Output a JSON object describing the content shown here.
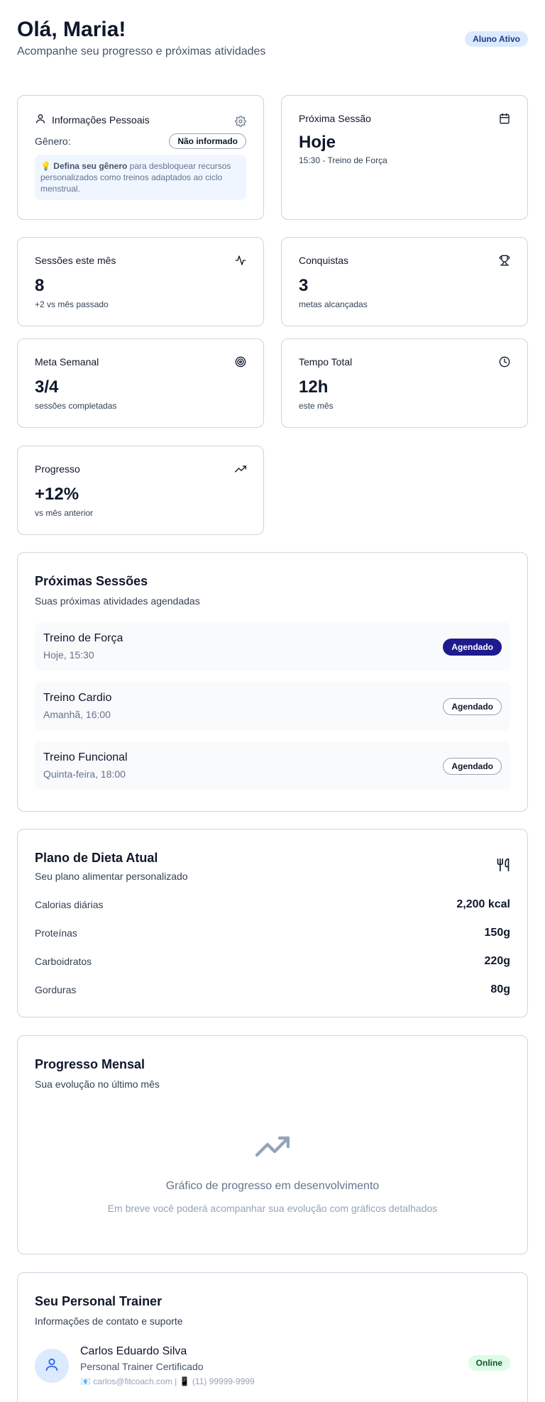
{
  "header": {
    "greeting": "Olá, Maria!",
    "subtitle": "Acompanhe seu progresso e próximas atividades",
    "status_badge": "Aluno Ativo"
  },
  "personal_info": {
    "title": "Informações Pessoais",
    "gender_label": "Gênero:",
    "gender_value": "Não informado",
    "tip_emoji": "💡",
    "tip_bold": "Defina seu gênero",
    "tip_text": " para desbloquear recursos personalizados como treinos adaptados ao ciclo menstrual."
  },
  "next_session": {
    "title": "Próxima Sessão",
    "day": "Hoje",
    "detail": "15:30 - Treino de Força"
  },
  "stats": {
    "sessions": {
      "title": "Sessões este mês",
      "value": "8",
      "sub": "+2 vs mês passado"
    },
    "achievements": {
      "title": "Conquistas",
      "value": "3",
      "sub": "metas alcançadas"
    },
    "weekly_goal": {
      "title": "Meta Semanal",
      "value": "3/4",
      "sub": "sessões completadas"
    },
    "total_time": {
      "title": "Tempo Total",
      "value": "12h",
      "sub": "este mês"
    },
    "progress": {
      "title": "Progresso",
      "value": "+12%",
      "sub": "vs mês anterior"
    }
  },
  "upcoming": {
    "title": "Próximas Sessões",
    "desc": "Suas próximas atividades agendadas",
    "items": [
      {
        "name": "Treino de Força",
        "when": "Hoje, 15:30",
        "status": "Agendado",
        "style": "filled"
      },
      {
        "name": "Treino Cardio",
        "when": "Amanhã, 16:00",
        "status": "Agendado",
        "style": "outline"
      },
      {
        "name": "Treino Funcional",
        "when": "Quinta-feira, 18:00",
        "status": "Agendado",
        "style": "outline"
      }
    ]
  },
  "diet": {
    "title": "Plano de Dieta Atual",
    "desc": "Seu plano alimentar personalizado",
    "rows": [
      {
        "label": "Calorias diárias",
        "value": "2,200 kcal"
      },
      {
        "label": "Proteínas",
        "value": "150g"
      },
      {
        "label": "Carboidratos",
        "value": "220g"
      },
      {
        "label": "Gorduras",
        "value": "80g"
      }
    ]
  },
  "monthly": {
    "title": "Progresso Mensal",
    "desc": "Sua evolução no último mês",
    "empty_title": "Gráfico de progresso em desenvolvimento",
    "empty_text": "Em breve você poderá acompanhar sua evolução com gráficos detalhados"
  },
  "trainer": {
    "title": "Seu Personal Trainer",
    "desc": "Informações de contato e suporte",
    "name": "Carlos Eduardo Silva",
    "role": "Personal Trainer Certificado",
    "contact": "📧 carlos@fitcoach.com | 📱 (11) 99999-9999",
    "status": "Online"
  },
  "colors": {
    "accent": "#1e1b8c",
    "badge_blue": "#dbeafe",
    "online_green": "#dcfce7"
  },
  "icons": [
    "user-icon",
    "gear-icon",
    "calendar-icon",
    "activity-icon",
    "trophy-icon",
    "target-icon",
    "clock-icon",
    "trending-up-icon",
    "utensils-icon"
  ]
}
